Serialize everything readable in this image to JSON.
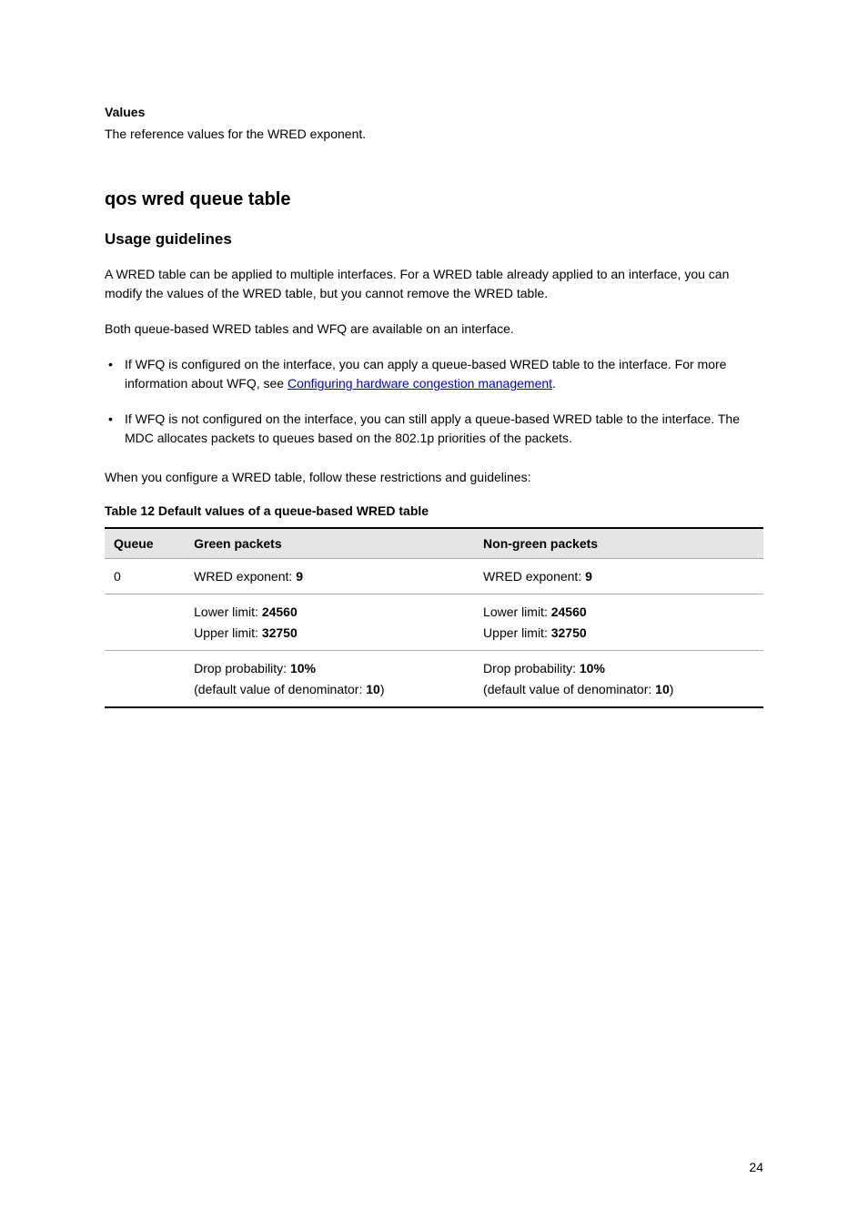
{
  "values": {
    "title": "Values",
    "text": "The reference values for the WRED exponent."
  },
  "section": {
    "heading": "qos wred queue table",
    "usage": {
      "heading": "Usage guidelines",
      "para1": "A WRED table can be applied to multiple interfaces. For a WRED table already applied to an interface, you can modify the values of the WRED table, but you cannot remove the WRED table.",
      "para2": "Both queue-based WRED tables and WFQ are available on an interface.",
      "bullets": [
        {
          "prefix": "If WFQ is configured on the interface, you can apply a queue-based WRED table to the interface. For more information about WFQ, see ",
          "link": "Configuring hardware congestion management",
          "suffix": "."
        },
        {
          "text": "If WFQ is not configured on the interface, you can still apply a queue-based WRED table to the interface. The MDC allocates packets to queues based on the 802.1p priorities of the packets."
        }
      ],
      "para3": "When you configure a WRED table, follow these restrictions and guidelines:"
    },
    "table": {
      "caption": "Table 12 Default values of a queue-based WRED table",
      "headers": [
        "Queue",
        "Green packets",
        "Non-green packets"
      ],
      "rows": [
        [
          "0",
          "WRED exponent: <b>9</b>",
          "WRED exponent: <b>9</b>"
        ],
        [
          "",
          "Lower limit: <b>24560</b><br>Upper limit: <b>32750</b>",
          "Lower limit: <b>24560</b><br>Upper limit: <b>32750</b>"
        ],
        [
          "",
          "Drop probability: <b>10%</b><br>(default value of denominator: <b>10</b>)",
          "Drop probability: <b>10%</b><br>(default value of denominator: <b>10</b>)"
        ]
      ]
    }
  },
  "pageNumber": "24"
}
